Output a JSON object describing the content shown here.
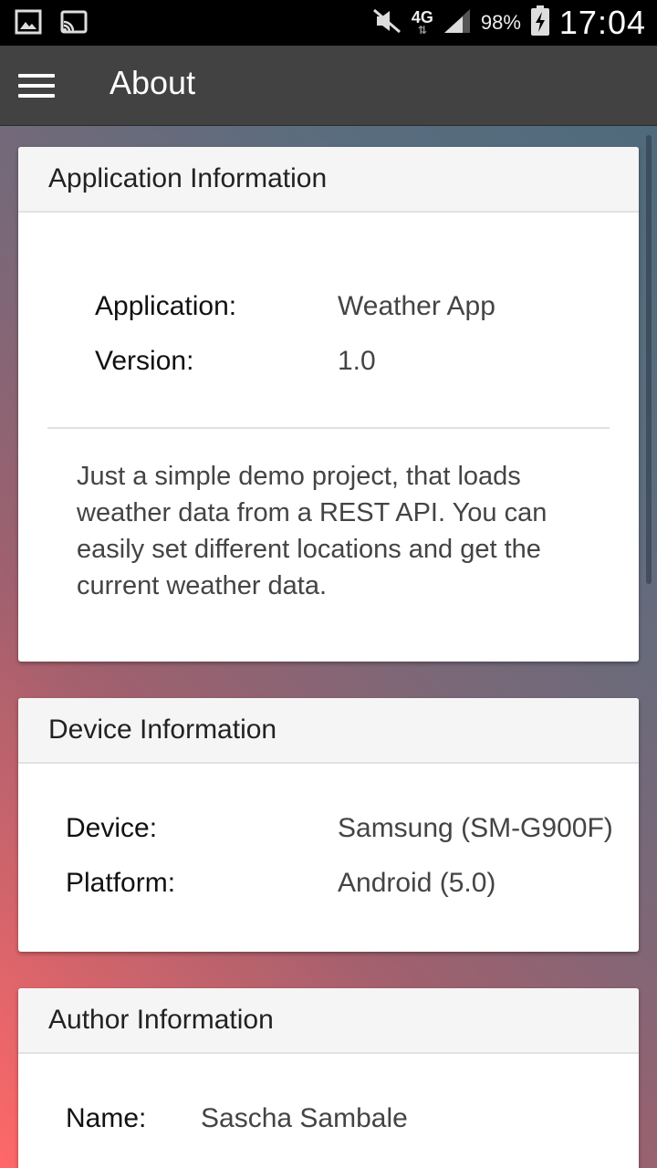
{
  "status_bar": {
    "icons": [
      "gallery-icon",
      "cast-icon",
      "mute-icon",
      "signal-icon",
      "battery-charging-icon"
    ],
    "network": "4G",
    "battery": "98%",
    "time": "17:04"
  },
  "app_bar": {
    "title": "About",
    "menu_icon": "hamburger-menu-icon"
  },
  "app_info": {
    "header": "Application Information",
    "application_label": "Application:",
    "application_value": "Weather App",
    "version_label": "Version:",
    "version_value": "1.0",
    "description": "Just a simple demo project, that loads weather data from a REST API. You can easily set different locations and get the current weather data."
  },
  "device_info": {
    "header": "Device Information",
    "device_label": "Device:",
    "device_value": "Samsung (SM-G900F)",
    "platform_label": "Platform:",
    "platform_value": "Android (5.0)"
  },
  "author_info": {
    "header": "Author Information",
    "name_label": "Name:",
    "name_value": "Sascha Sambale"
  },
  "colors": {
    "status_bar": "#000000",
    "app_bar": "#424242",
    "gradient_start": "#ff6868",
    "gradient_end": "#4f6a7c",
    "card_header": "#f5f5f5"
  }
}
